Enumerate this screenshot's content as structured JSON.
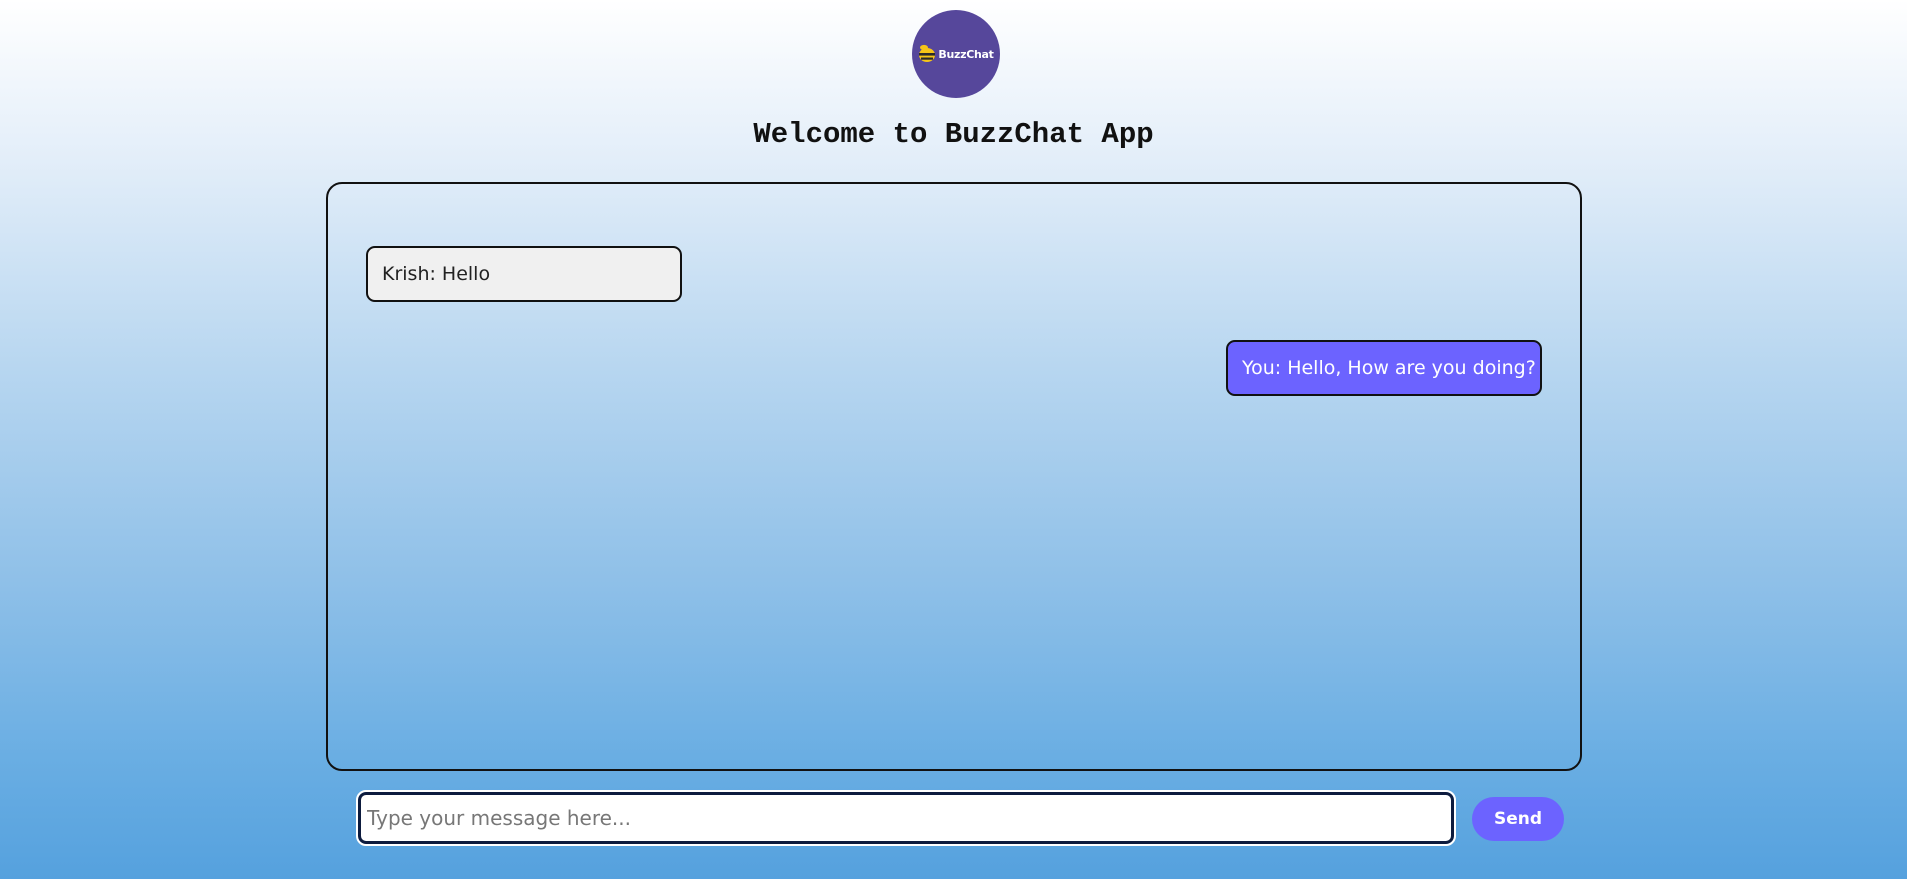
{
  "app": {
    "logo_text": "BuzzChat",
    "logo_icon": "bee-icon",
    "title": "Welcome to BuzzChat App"
  },
  "messages": [
    {
      "sender": "Krish",
      "text": "Krish: Hello",
      "direction": "received"
    },
    {
      "sender": "You",
      "text": "You: Hello, How are you doing?",
      "direction": "sent"
    }
  ],
  "composer": {
    "value": "",
    "placeholder": "Type your message here...",
    "send_label": "Send"
  },
  "colors": {
    "brand": "#56479b",
    "accent": "#6c63ff",
    "received_bubble": "#f0f0f0"
  }
}
